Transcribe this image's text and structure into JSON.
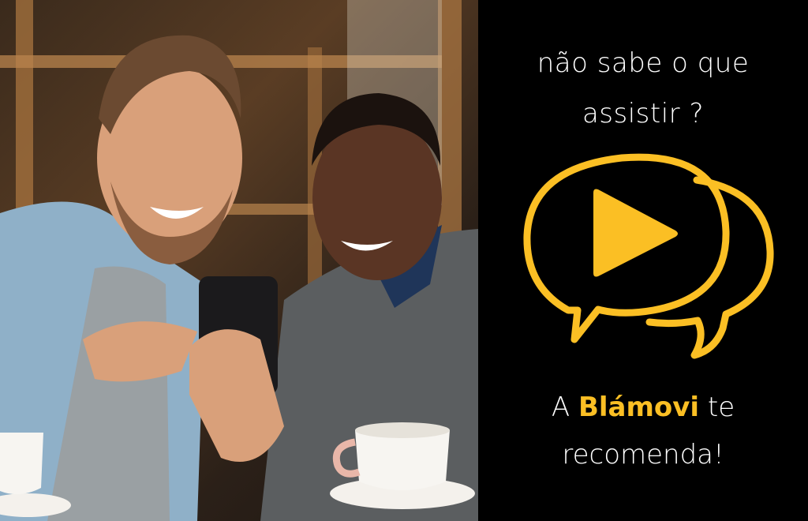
{
  "headline": {
    "line1": "não sabe o que",
    "line2": "assistir ?"
  },
  "tagline": {
    "prefix": "A",
    "brand": "Blámovi",
    "suffix": "te",
    "line2": "recomenda!"
  },
  "photo": {
    "icon": "two-men-laughing-at-phone-photo"
  },
  "logo": {
    "icon": "play-speech-bubbles-icon",
    "color": "#fbbf24"
  },
  "colors": {
    "background": "#000000",
    "text": "#ffffff",
    "accent": "#fbbf24"
  }
}
